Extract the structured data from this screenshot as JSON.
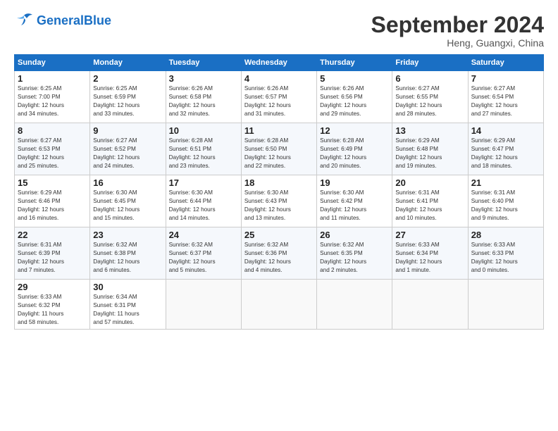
{
  "header": {
    "logo_general": "General",
    "logo_blue": "Blue",
    "month": "September 2024",
    "location": "Heng, Guangxi, China"
  },
  "days_of_week": [
    "Sunday",
    "Monday",
    "Tuesday",
    "Wednesday",
    "Thursday",
    "Friday",
    "Saturday"
  ],
  "weeks": [
    [
      {
        "day": "1",
        "info": "Sunrise: 6:25 AM\nSunset: 7:00 PM\nDaylight: 12 hours\nand 34 minutes."
      },
      {
        "day": "2",
        "info": "Sunrise: 6:25 AM\nSunset: 6:59 PM\nDaylight: 12 hours\nand 33 minutes."
      },
      {
        "day": "3",
        "info": "Sunrise: 6:26 AM\nSunset: 6:58 PM\nDaylight: 12 hours\nand 32 minutes."
      },
      {
        "day": "4",
        "info": "Sunrise: 6:26 AM\nSunset: 6:57 PM\nDaylight: 12 hours\nand 31 minutes."
      },
      {
        "day": "5",
        "info": "Sunrise: 6:26 AM\nSunset: 6:56 PM\nDaylight: 12 hours\nand 29 minutes."
      },
      {
        "day": "6",
        "info": "Sunrise: 6:27 AM\nSunset: 6:55 PM\nDaylight: 12 hours\nand 28 minutes."
      },
      {
        "day": "7",
        "info": "Sunrise: 6:27 AM\nSunset: 6:54 PM\nDaylight: 12 hours\nand 27 minutes."
      }
    ],
    [
      {
        "day": "8",
        "info": "Sunrise: 6:27 AM\nSunset: 6:53 PM\nDaylight: 12 hours\nand 25 minutes."
      },
      {
        "day": "9",
        "info": "Sunrise: 6:27 AM\nSunset: 6:52 PM\nDaylight: 12 hours\nand 24 minutes."
      },
      {
        "day": "10",
        "info": "Sunrise: 6:28 AM\nSunset: 6:51 PM\nDaylight: 12 hours\nand 23 minutes."
      },
      {
        "day": "11",
        "info": "Sunrise: 6:28 AM\nSunset: 6:50 PM\nDaylight: 12 hours\nand 22 minutes."
      },
      {
        "day": "12",
        "info": "Sunrise: 6:28 AM\nSunset: 6:49 PM\nDaylight: 12 hours\nand 20 minutes."
      },
      {
        "day": "13",
        "info": "Sunrise: 6:29 AM\nSunset: 6:48 PM\nDaylight: 12 hours\nand 19 minutes."
      },
      {
        "day": "14",
        "info": "Sunrise: 6:29 AM\nSunset: 6:47 PM\nDaylight: 12 hours\nand 18 minutes."
      }
    ],
    [
      {
        "day": "15",
        "info": "Sunrise: 6:29 AM\nSunset: 6:46 PM\nDaylight: 12 hours\nand 16 minutes."
      },
      {
        "day": "16",
        "info": "Sunrise: 6:30 AM\nSunset: 6:45 PM\nDaylight: 12 hours\nand 15 minutes."
      },
      {
        "day": "17",
        "info": "Sunrise: 6:30 AM\nSunset: 6:44 PM\nDaylight: 12 hours\nand 14 minutes."
      },
      {
        "day": "18",
        "info": "Sunrise: 6:30 AM\nSunset: 6:43 PM\nDaylight: 12 hours\nand 13 minutes."
      },
      {
        "day": "19",
        "info": "Sunrise: 6:30 AM\nSunset: 6:42 PM\nDaylight: 12 hours\nand 11 minutes."
      },
      {
        "day": "20",
        "info": "Sunrise: 6:31 AM\nSunset: 6:41 PM\nDaylight: 12 hours\nand 10 minutes."
      },
      {
        "day": "21",
        "info": "Sunrise: 6:31 AM\nSunset: 6:40 PM\nDaylight: 12 hours\nand 9 minutes."
      }
    ],
    [
      {
        "day": "22",
        "info": "Sunrise: 6:31 AM\nSunset: 6:39 PM\nDaylight: 12 hours\nand 7 minutes."
      },
      {
        "day": "23",
        "info": "Sunrise: 6:32 AM\nSunset: 6:38 PM\nDaylight: 12 hours\nand 6 minutes."
      },
      {
        "day": "24",
        "info": "Sunrise: 6:32 AM\nSunset: 6:37 PM\nDaylight: 12 hours\nand 5 minutes."
      },
      {
        "day": "25",
        "info": "Sunrise: 6:32 AM\nSunset: 6:36 PM\nDaylight: 12 hours\nand 4 minutes."
      },
      {
        "day": "26",
        "info": "Sunrise: 6:32 AM\nSunset: 6:35 PM\nDaylight: 12 hours\nand 2 minutes."
      },
      {
        "day": "27",
        "info": "Sunrise: 6:33 AM\nSunset: 6:34 PM\nDaylight: 12 hours\nand 1 minute."
      },
      {
        "day": "28",
        "info": "Sunrise: 6:33 AM\nSunset: 6:33 PM\nDaylight: 12 hours\nand 0 minutes."
      }
    ],
    [
      {
        "day": "29",
        "info": "Sunrise: 6:33 AM\nSunset: 6:32 PM\nDaylight: 11 hours\nand 58 minutes."
      },
      {
        "day": "30",
        "info": "Sunrise: 6:34 AM\nSunset: 6:31 PM\nDaylight: 11 hours\nand 57 minutes."
      },
      {
        "day": "",
        "info": ""
      },
      {
        "day": "",
        "info": ""
      },
      {
        "day": "",
        "info": ""
      },
      {
        "day": "",
        "info": ""
      },
      {
        "day": "",
        "info": ""
      }
    ]
  ]
}
